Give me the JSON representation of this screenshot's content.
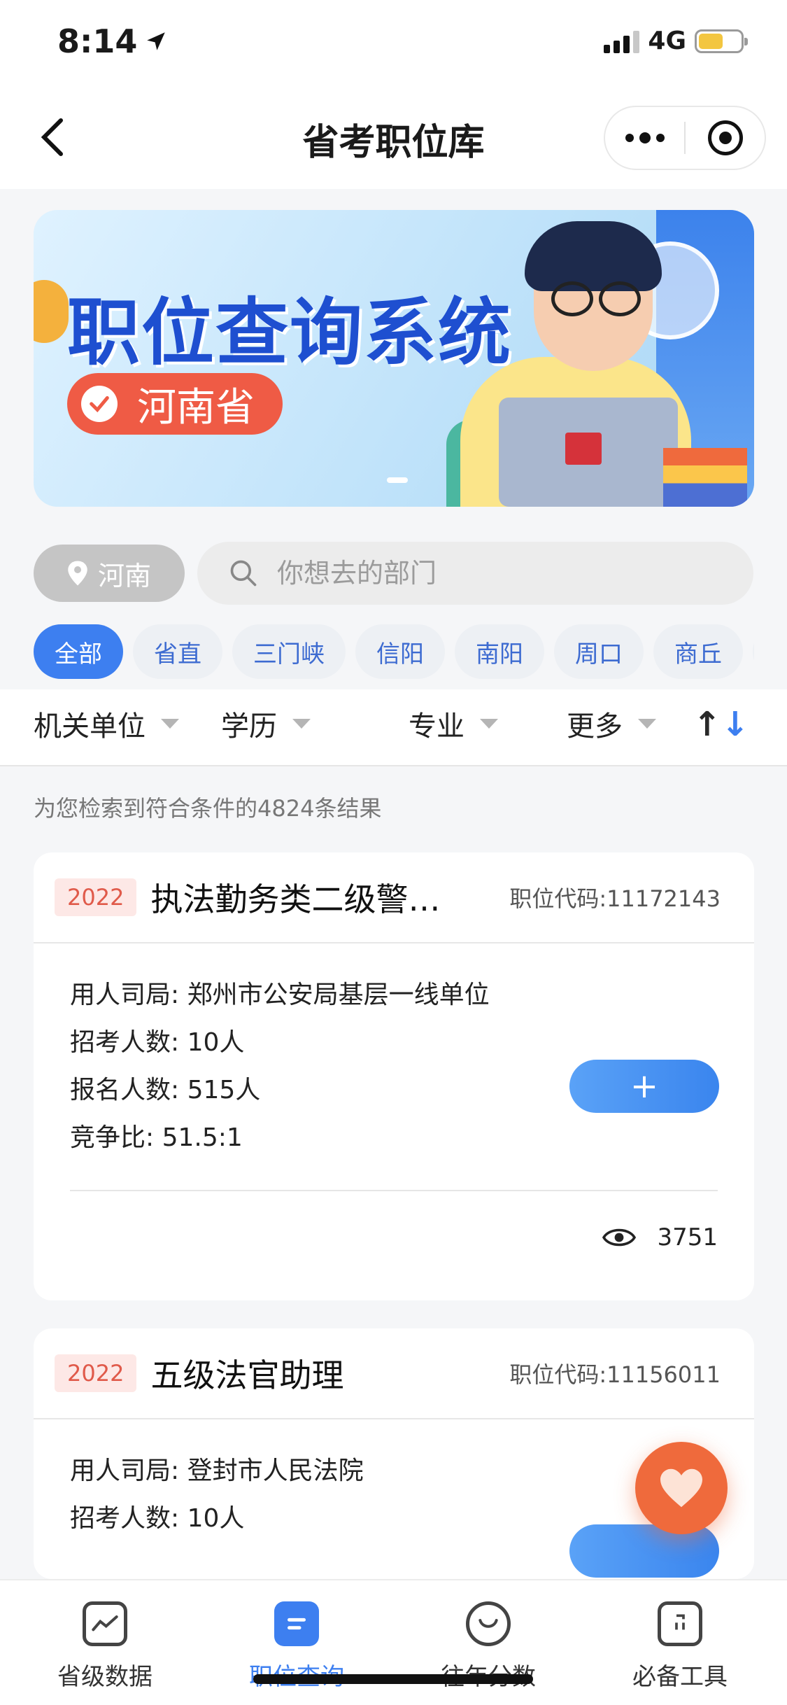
{
  "status": {
    "time": "8:14",
    "network": "4G"
  },
  "nav": {
    "title": "省考职位库"
  },
  "banner": {
    "title": "职位查询系统",
    "badge": "河南省"
  },
  "location": {
    "label": "河南"
  },
  "search": {
    "placeholder": "你想去的部门",
    "value": ""
  },
  "chips": [
    "全部",
    "省直",
    "三门峡",
    "信阳",
    "南阳",
    "周口",
    "商丘"
  ],
  "filters": [
    "机关单位",
    "学历",
    "专业",
    "更多"
  ],
  "result_text": "为您检索到符合条件的4824条结果",
  "cards": [
    {
      "year": "2022",
      "title": "执法勤务类二级警…",
      "code": "职位代码:11172143",
      "rows": [
        "用人司局: 郑州市公安局基层一线单位",
        "招考人数: 10人",
        "报名人数: 515人",
        "竞争比: 51.5:1"
      ],
      "add_label": "+",
      "views": "3751"
    },
    {
      "year": "2022",
      "title": "五级法官助理",
      "code": "职位代码:11156011",
      "rows": [
        "用人司局: 登封市人民法院",
        "招考人数: 10人"
      ]
    }
  ],
  "tabs": [
    {
      "label": "省级数据",
      "icon": "chart-icon"
    },
    {
      "label": "职位查询",
      "icon": "list-icon"
    },
    {
      "label": "往年分数",
      "icon": "smile-icon"
    },
    {
      "label": "必备工具",
      "icon": "toolbox-icon"
    }
  ],
  "colors": {
    "accent": "#3d7ff0",
    "badge": "#ef5b45",
    "fab": "#ef6a3c"
  }
}
